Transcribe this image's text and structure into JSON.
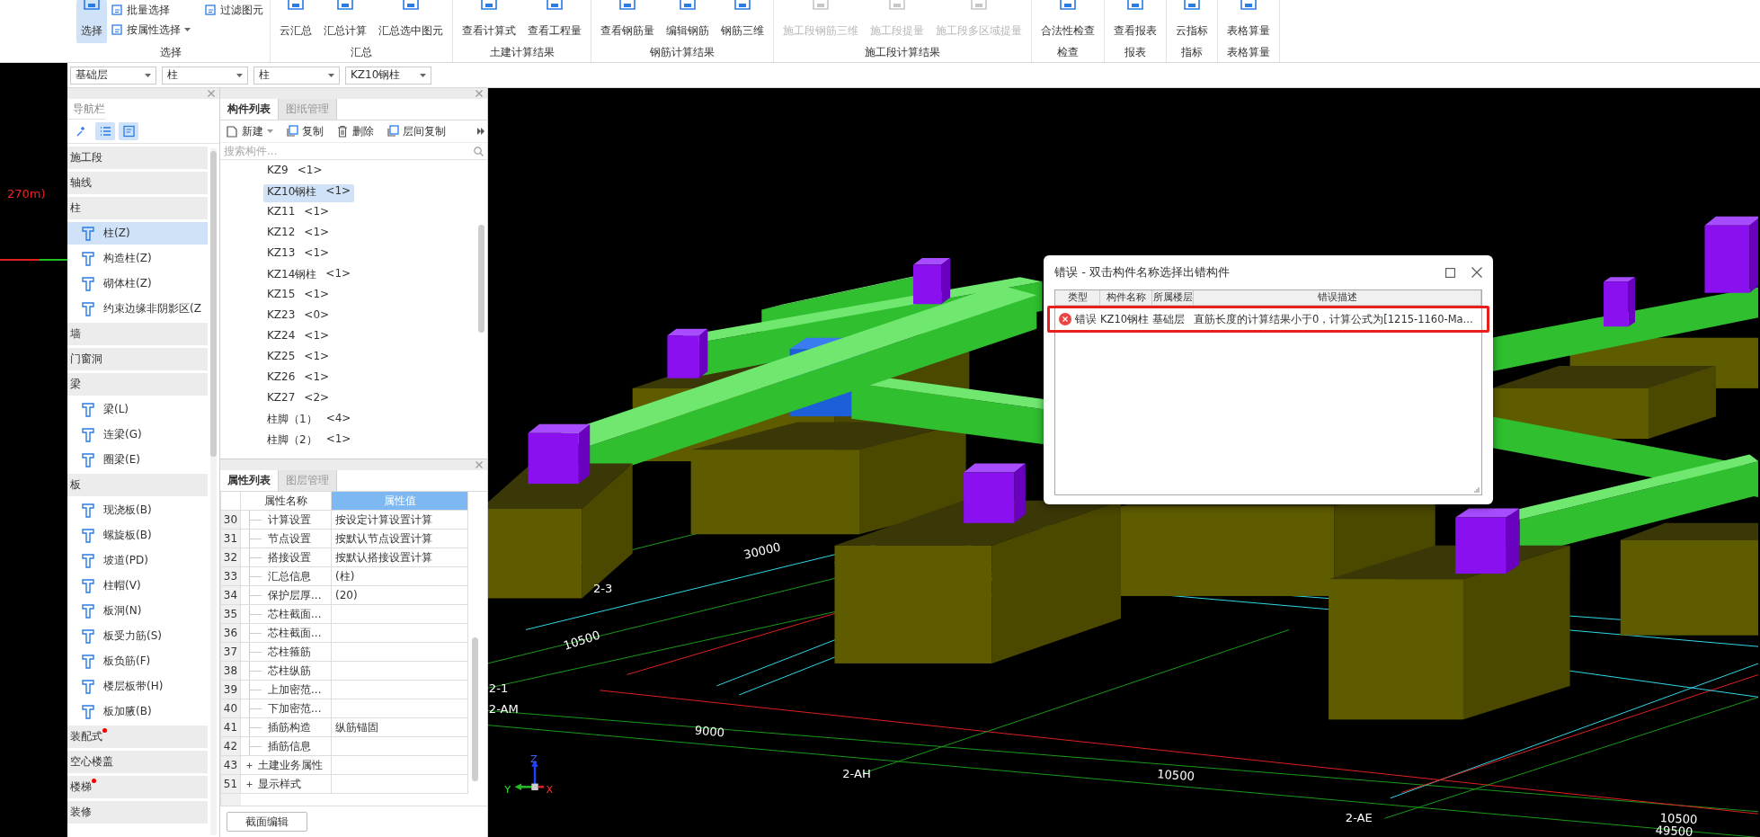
{
  "ribbon": {
    "groups": [
      {
        "label": "选择",
        "buttons": [
          {
            "label": "选择",
            "kind": "large",
            "selected": true,
            "disabled": false
          },
          {
            "label": "批量选择",
            "kind": "small",
            "selected": false,
            "disabled": false,
            "dropdown": false
          },
          {
            "label": "按属性选择",
            "kind": "small",
            "selected": false,
            "disabled": false,
            "dropdown": true
          },
          {
            "label": "过滤图元",
            "kind": "small",
            "selected": false,
            "disabled": false,
            "dropdown": false
          }
        ]
      },
      {
        "label": "汇总",
        "buttons": [
          {
            "label": "云汇总",
            "kind": "large",
            "selected": false,
            "disabled": false
          },
          {
            "label": "汇总计算",
            "kind": "large",
            "selected": false,
            "disabled": false
          },
          {
            "label": "汇总选中图元",
            "kind": "large",
            "selected": false,
            "disabled": false
          }
        ]
      },
      {
        "label": "土建计算结果",
        "buttons": [
          {
            "label": "查看计算式",
            "kind": "large",
            "selected": false,
            "disabled": false
          },
          {
            "label": "查看工程量",
            "kind": "large",
            "selected": false,
            "disabled": false
          }
        ]
      },
      {
        "label": "钢筋计算结果",
        "buttons": [
          {
            "label": "查看钢筋量",
            "kind": "large",
            "selected": false,
            "disabled": false
          },
          {
            "label": "编辑钢筋",
            "kind": "large",
            "selected": false,
            "disabled": false
          },
          {
            "label": "钢筋三维",
            "kind": "large",
            "selected": false,
            "disabled": false
          }
        ]
      },
      {
        "label": "施工段计算结果",
        "buttons": [
          {
            "label": "施工段钢筋三维",
            "kind": "large",
            "selected": false,
            "disabled": true
          },
          {
            "label": "施工段提量",
            "kind": "large",
            "selected": false,
            "disabled": true
          },
          {
            "label": "施工段多区域提量",
            "kind": "large",
            "selected": false,
            "disabled": true
          }
        ]
      },
      {
        "label": "检查",
        "buttons": [
          {
            "label": "合法性检查",
            "kind": "large",
            "selected": false,
            "disabled": false
          }
        ]
      },
      {
        "label": "报表",
        "buttons": [
          {
            "label": "查看报表",
            "kind": "large",
            "selected": false,
            "disabled": false
          }
        ]
      },
      {
        "label": "指标",
        "buttons": [
          {
            "label": "云指标",
            "kind": "large",
            "selected": false,
            "disabled": false
          }
        ]
      },
      {
        "label": "表格算量",
        "buttons": [
          {
            "label": "表格算量",
            "kind": "large",
            "selected": false,
            "disabled": false
          }
        ]
      }
    ]
  },
  "selectors": [
    "基础层",
    "柱",
    "柱",
    "KZ10钢柱"
  ],
  "left_view": {
    "text": "270m)"
  },
  "nav": {
    "title": "导航栏",
    "view_buttons": [
      {
        "selected": false
      },
      {
        "selected": true
      },
      {
        "selected": true
      }
    ],
    "sections": [
      {
        "label": "施工段",
        "new_dot": false
      },
      {
        "label": "轴线",
        "new_dot": false
      },
      {
        "label": "柱",
        "new_dot": false,
        "items": [
          {
            "label": "柱(Z)",
            "selected": true
          },
          {
            "label": "构造柱(Z)",
            "selected": false
          },
          {
            "label": "砌体柱(Z)",
            "selected": false
          },
          {
            "label": "约束边缘非阴影区(Z",
            "selected": false
          }
        ]
      },
      {
        "label": "墙",
        "new_dot": false
      },
      {
        "label": "门窗洞",
        "new_dot": false
      },
      {
        "label": "梁",
        "new_dot": false,
        "items": [
          {
            "label": "梁(L)",
            "selected": false
          },
          {
            "label": "连梁(G)",
            "selected": false
          },
          {
            "label": "圈梁(E)",
            "selected": false
          }
        ]
      },
      {
        "label": "板",
        "new_dot": false,
        "items": [
          {
            "label": "现浇板(B)",
            "selected": false
          },
          {
            "label": "螺旋板(B)",
            "selected": false
          },
          {
            "label": "坡道(PD)",
            "selected": false
          },
          {
            "label": "柱帽(V)",
            "selected": false
          },
          {
            "label": "板洞(N)",
            "selected": false
          },
          {
            "label": "板受力筋(S)",
            "selected": false
          },
          {
            "label": "板负筋(F)",
            "selected": false
          },
          {
            "label": "楼层板带(H)",
            "selected": false
          },
          {
            "label": "板加腋(B)",
            "selected": false
          }
        ]
      },
      {
        "label": "装配式",
        "new_dot": true
      },
      {
        "label": "空心楼盖",
        "new_dot": false
      },
      {
        "label": "楼梯",
        "new_dot": true
      },
      {
        "label": "装修",
        "new_dot": false
      }
    ]
  },
  "components": {
    "tabs": [
      {
        "label": "构件列表",
        "selected": true
      },
      {
        "label": "图纸管理",
        "selected": false
      }
    ],
    "toolbar": [
      {
        "label": "新建",
        "dropdown": true
      },
      {
        "label": "复制",
        "dropdown": false
      },
      {
        "label": "删除",
        "dropdown": false
      },
      {
        "label": "层间复制",
        "dropdown": false
      }
    ],
    "search": {
      "placeholder": "搜索构件..."
    },
    "items": [
      {
        "name": "KZ9",
        "count": "<1>",
        "selected": false
      },
      {
        "name": "KZ10钢柱",
        "count": "<1>",
        "selected": true
      },
      {
        "name": "KZ11",
        "count": "<1>",
        "selected": false
      },
      {
        "name": "KZ12",
        "count": "<1>",
        "selected": false
      },
      {
        "name": "KZ13",
        "count": "<1>",
        "selected": false
      },
      {
        "name": "KZ14钢柱",
        "count": "<1>",
        "selected": false
      },
      {
        "name": "KZ15",
        "count": "<1>",
        "selected": false
      },
      {
        "name": "KZ23",
        "count": "<0>",
        "selected": false
      },
      {
        "name": "KZ24",
        "count": "<1>",
        "selected": false
      },
      {
        "name": "KZ25",
        "count": "<1>",
        "selected": false
      },
      {
        "name": "KZ26",
        "count": "<1>",
        "selected": false
      },
      {
        "name": "KZ27",
        "count": "<2>",
        "selected": false
      },
      {
        "name": "柱脚（1）",
        "count": "<4>",
        "selected": false
      },
      {
        "name": "柱脚（2）",
        "count": "<1>",
        "selected": false
      }
    ]
  },
  "properties": {
    "tabs": [
      {
        "label": "属性列表",
        "selected": true
      },
      {
        "label": "图层管理",
        "selected": false
      }
    ],
    "columns": [
      "属性名称",
      "属性值"
    ],
    "rows": [
      {
        "no": "30",
        "name": "计算设置",
        "value": "按设定计算设置计算",
        "kind": "child"
      },
      {
        "no": "31",
        "name": "节点设置",
        "value": "按默认节点设置计算",
        "kind": "child"
      },
      {
        "no": "32",
        "name": "搭接设置",
        "value": "按默认搭接设置计算",
        "kind": "child"
      },
      {
        "no": "33",
        "name": "汇总信息",
        "value": "(柱)",
        "kind": "child"
      },
      {
        "no": "34",
        "name": "保护层厚...",
        "value": "(20)",
        "kind": "child"
      },
      {
        "no": "35",
        "name": "芯柱截面...",
        "kind": "child"
      },
      {
        "no": "36",
        "name": "芯柱截面...",
        "kind": "child"
      },
      {
        "no": "37",
        "name": "芯柱箍筋",
        "kind": "child"
      },
      {
        "no": "38",
        "name": "芯柱纵筋",
        "kind": "child"
      },
      {
        "no": "39",
        "name": "上加密范...",
        "kind": "child"
      },
      {
        "no": "40",
        "name": "下加密范...",
        "kind": "child"
      },
      {
        "no": "41",
        "name": "插筋构造",
        "value": "纵筋锚固",
        "kind": "child"
      },
      {
        "no": "42",
        "name": "插筋信息",
        "kind": "child"
      },
      {
        "no": "43",
        "name": "土建业务属性",
        "kind": "group",
        "expanded": false
      },
      {
        "no": "51",
        "name": "显示样式",
        "kind": "group",
        "expanded": false
      }
    ],
    "button": "截面编辑"
  },
  "scene": {
    "grid_labels": [
      "2-3",
      "30000",
      "10500",
      "2-1",
      "2-AM",
      "9000",
      "2-AH",
      "10500",
      "2-AE",
      "10500",
      "49500"
    ],
    "axis_letters": {
      "x": "X",
      "y": "Y",
      "z": "Z"
    }
  },
  "dialog": {
    "title": "错误 - 双击构件名称选择出错构件",
    "columns": [
      "类型",
      "构件名称",
      "所属楼层",
      "错误描述"
    ],
    "rows": [
      {
        "type": "错误",
        "component": "KZ10钢柱",
        "floor": "基础层",
        "description": "直筋长度的计算结果小于0，计算公式为[1215-1160-Ma...",
        "highlighted": true
      }
    ]
  }
}
